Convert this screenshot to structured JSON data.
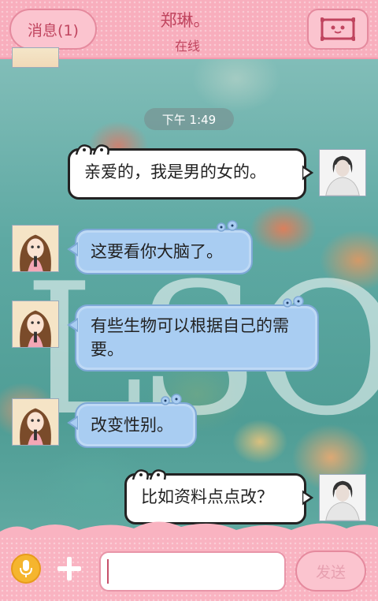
{
  "header": {
    "back_label": "消息(1)",
    "contact_name": "郑琳。",
    "contact_status": "在线",
    "profile_icon": "contact-card-icon"
  },
  "background_letters": "LSO",
  "timestamp": "下午 1:49",
  "messages": [
    {
      "side": "self",
      "text": "亲爱的，我是男的女的。"
    },
    {
      "side": "other",
      "text": "这要看你大脑了。"
    },
    {
      "side": "other",
      "text": "有些生物可以根据自己的需要。"
    },
    {
      "side": "other",
      "text": "改变性别。"
    },
    {
      "side": "self",
      "text": "比如资料点点改？"
    }
  ],
  "input_bar": {
    "voice_icon": "microphone-icon",
    "add_icon": "plus-icon",
    "input_value": "",
    "input_placeholder": "",
    "send_label": "发送"
  },
  "colors": {
    "header_pink": "#f8aebd",
    "accent_text": "#c0455f",
    "incoming_bubble": "#a9cdf2",
    "outgoing_bubble": "#ffffff"
  }
}
